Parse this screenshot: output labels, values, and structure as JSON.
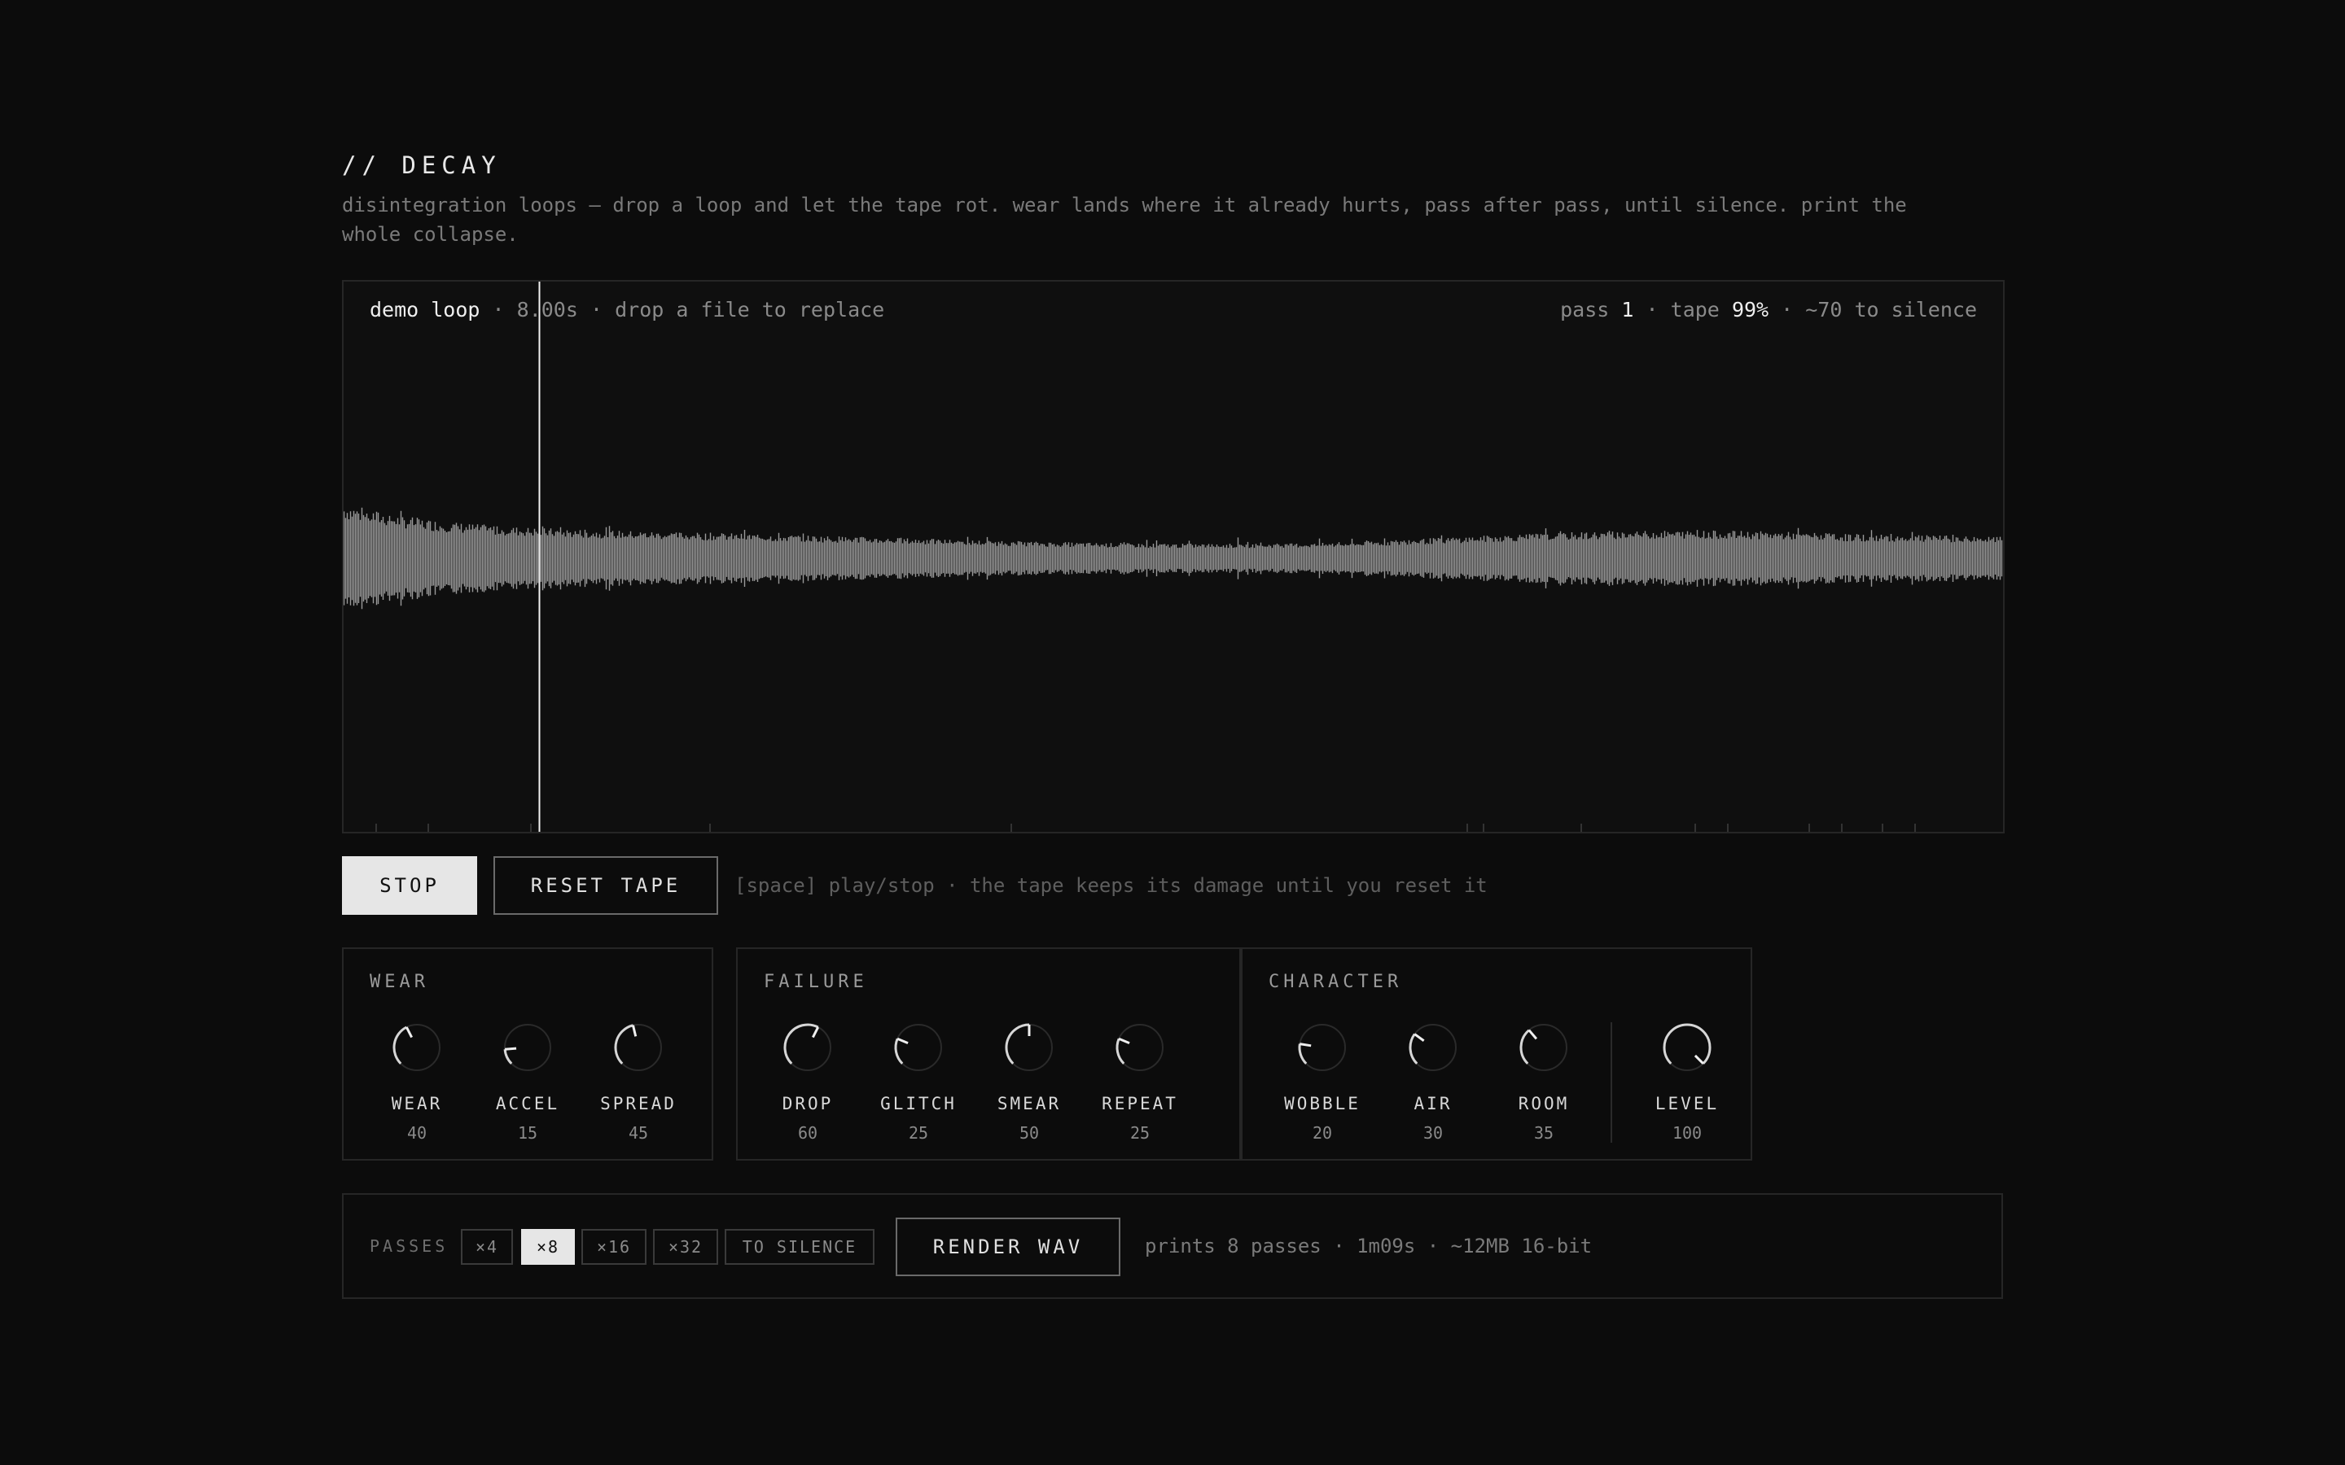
{
  "header": {
    "title": "// DECAY",
    "description": "disintegration loops — drop a loop and let the tape rot. wear lands where it already hurts, pass after pass, until silence. print the whole collapse."
  },
  "waveform": {
    "loop_name": "demo loop",
    "duration": "8.00s",
    "drop_hint": "drop a file to replace",
    "separator": "·",
    "pass_label": "pass",
    "pass_value": "1",
    "tape_label": "tape",
    "tape_value": "99%",
    "silence_text": "~70 to silence",
    "playhead_position": 0.118
  },
  "transport": {
    "stop_label": "STOP",
    "reset_label": "RESET TAPE",
    "hint": "[space] play/stop  ·  the tape keeps its damage until you reset it"
  },
  "panels": {
    "wear": {
      "title": "WEAR",
      "knobs": [
        {
          "label": "WEAR",
          "value": "40"
        },
        {
          "label": "ACCEL",
          "value": "15"
        },
        {
          "label": "SPREAD",
          "value": "45"
        }
      ]
    },
    "failure": {
      "title": "FAILURE",
      "knobs": [
        {
          "label": "DROP",
          "value": "60"
        },
        {
          "label": "GLITCH",
          "value": "25"
        },
        {
          "label": "SMEAR",
          "value": "50"
        },
        {
          "label": "REPEAT",
          "value": "25"
        }
      ]
    },
    "character": {
      "title": "CHARACTER",
      "knobs": [
        {
          "label": "WOBBLE",
          "value": "20"
        },
        {
          "label": "AIR",
          "value": "30"
        },
        {
          "label": "ROOM",
          "value": "35"
        },
        {
          "label": "LEVEL",
          "value": "100"
        }
      ]
    }
  },
  "render": {
    "passes_label": "PASSES",
    "options": [
      "×4",
      "×8",
      "×16",
      "×32",
      "TO SILENCE"
    ],
    "selected": "×8",
    "render_label": "RENDER WAV",
    "info": "prints 8 passes · 1m09s · ~12MB 16-bit"
  },
  "colors": {
    "background": "#0c0c0c",
    "accent": "#e6e6e6",
    "waveform": "#9a9a9a",
    "border": "#262626"
  }
}
